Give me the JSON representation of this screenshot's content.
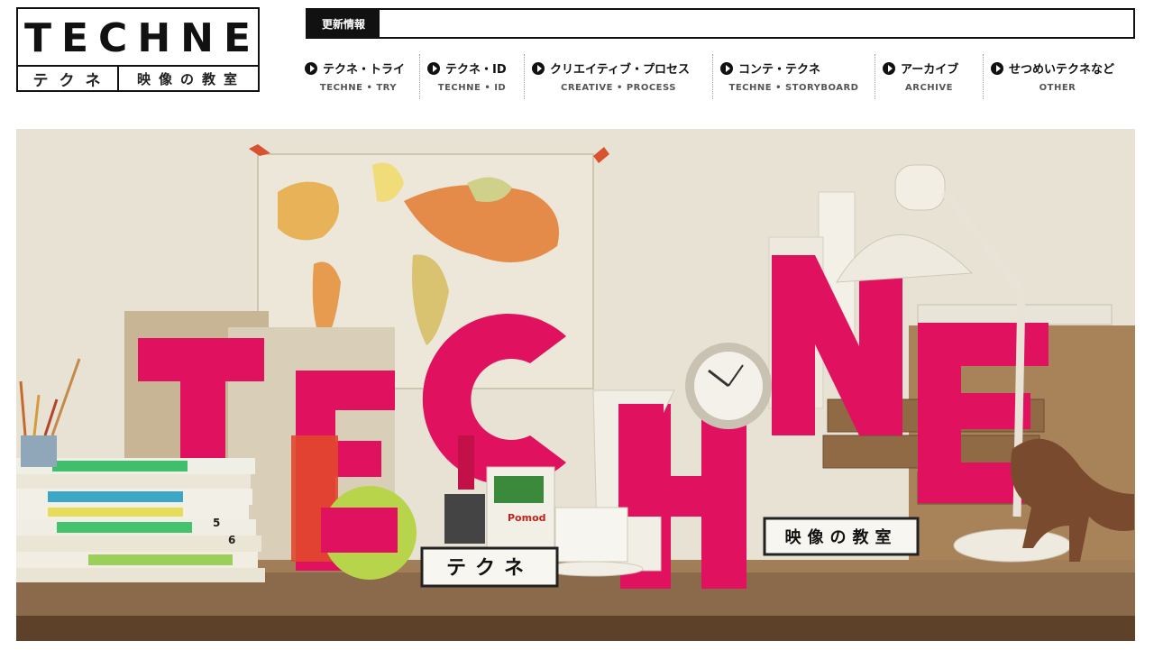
{
  "logo": {
    "main": "TECHNE",
    "sub_kana": "テクネ",
    "sub_kanji": "映像の教室"
  },
  "news": {
    "label": "更新情報",
    "text": ""
  },
  "nav": [
    {
      "jp": "テクネ・トライ",
      "en": "TECHNE • TRY"
    },
    {
      "jp": "テクネ・ID",
      "en": "TECHNE • ID"
    },
    {
      "jp": "クリエイティブ・プロセス",
      "en": "CREATIVE • PROCESS"
    },
    {
      "jp": "コンテ・テクネ",
      "en": "TECHNE • STORYBOARD"
    },
    {
      "jp": "アーカイブ",
      "en": "ARCHIVE"
    },
    {
      "jp": "せつめいテクネなど",
      "en": "OTHER"
    }
  ],
  "hero": {
    "sign_kana": "テクネ",
    "sign_kanji": "映像の教室",
    "book_number": "5",
    "book_number_2": "6",
    "tin_label": "Pomod",
    "colors": {
      "magenta": "#e0115f",
      "wall": "#e8e2d4",
      "desk": "#8a6a4a",
      "apple": "#b7d44a"
    }
  }
}
